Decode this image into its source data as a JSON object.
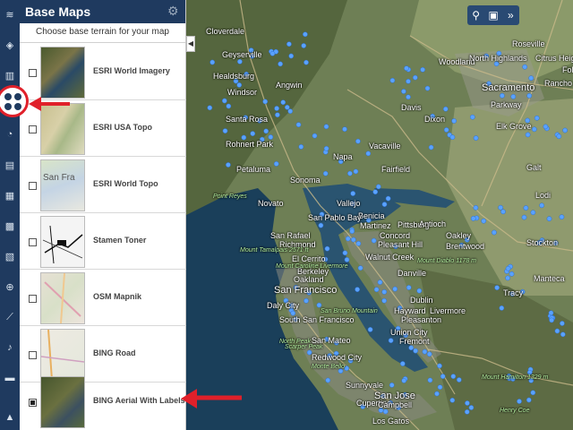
{
  "panel": {
    "title": "Base Maps",
    "subtitle": "Choose base terrain for your map",
    "items": [
      {
        "label": "ESRI World Imagery",
        "checked": false
      },
      {
        "label": "ESRI USA Topo",
        "checked": false
      },
      {
        "label": "ESRI World Topo",
        "checked": false
      },
      {
        "label": "Stamen Toner",
        "checked": false
      },
      {
        "label": "OSM Mapnik",
        "checked": false
      },
      {
        "label": "BING Road",
        "checked": false
      },
      {
        "label": "BING Aerial With Labels",
        "checked": true
      }
    ]
  },
  "thumb_text": {
    "world_topo": "San Fra"
  },
  "map": {
    "places": [
      {
        "name": "Cloverdale",
        "size": "n"
      },
      {
        "name": "Geyserville",
        "size": "n"
      },
      {
        "name": "Healdsburg",
        "size": "n"
      },
      {
        "name": "Windsor",
        "size": "n"
      },
      {
        "name": "Santa Rosa",
        "size": "n"
      },
      {
        "name": "Rohnert Park",
        "size": "n"
      },
      {
        "name": "Petaluma",
        "size": "n"
      },
      {
        "name": "Novato",
        "size": "n"
      },
      {
        "name": "San Rafael",
        "size": "n"
      },
      {
        "name": "Richmond",
        "size": "n"
      },
      {
        "name": "El Cerrito",
        "size": "n"
      },
      {
        "name": "Berkeley",
        "size": "n"
      },
      {
        "name": "Oakland",
        "size": "n"
      },
      {
        "name": "San Francisco",
        "size": "b"
      },
      {
        "name": "Daly City",
        "size": "n"
      },
      {
        "name": "South San Francisco",
        "size": "n"
      },
      {
        "name": "San Mateo",
        "size": "n"
      },
      {
        "name": "Redwood City",
        "size": "n"
      },
      {
        "name": "Sunnyvale",
        "size": "n"
      },
      {
        "name": "San Jose",
        "size": "b"
      },
      {
        "name": "Cupertino",
        "size": "n"
      },
      {
        "name": "Campbell",
        "size": "n"
      },
      {
        "name": "Los Gatos",
        "size": "n"
      },
      {
        "name": "Fremont",
        "size": "n"
      },
      {
        "name": "Union City",
        "size": "n"
      },
      {
        "name": "Hayward",
        "size": "n"
      },
      {
        "name": "Pleasanton",
        "size": "n"
      },
      {
        "name": "Livermore",
        "size": "n"
      },
      {
        "name": "Dublin",
        "size": "n"
      },
      {
        "name": "Danville",
        "size": "n"
      },
      {
        "name": "Walnut Creek",
        "size": "n"
      },
      {
        "name": "Concord",
        "size": "n"
      },
      {
        "name": "Pleasant Hill",
        "size": "n"
      },
      {
        "name": "Martinez",
        "size": "n"
      },
      {
        "name": "Pittsburg",
        "size": "n"
      },
      {
        "name": "Antioch",
        "size": "n"
      },
      {
        "name": "Oakley",
        "size": "n"
      },
      {
        "name": "Brentwood",
        "size": "n"
      },
      {
        "name": "Vallejo",
        "size": "n"
      },
      {
        "name": "Benicia",
        "size": "n"
      },
      {
        "name": "Napa",
        "size": "n"
      },
      {
        "name": "Fairfield",
        "size": "n"
      },
      {
        "name": "Vacaville",
        "size": "n"
      },
      {
        "name": "Dixon",
        "size": "n"
      },
      {
        "name": "Davis",
        "size": "n"
      },
      {
        "name": "Woodland",
        "size": "n"
      },
      {
        "name": "Sacramento",
        "size": "b"
      },
      {
        "name": "Elk Grove",
        "size": "n"
      },
      {
        "name": "Galt",
        "size": "n"
      },
      {
        "name": "Lodi",
        "size": "n"
      },
      {
        "name": "Stockton",
        "size": "n"
      },
      {
        "name": "Manteca",
        "size": "n"
      },
      {
        "name": "Tracy",
        "size": "n"
      },
      {
        "name": "Roseville",
        "size": "n"
      },
      {
        "name": "North Highlands",
        "size": "n"
      },
      {
        "name": "Citrus Heights",
        "size": "n"
      },
      {
        "name": "Folsom",
        "size": "n"
      },
      {
        "name": "Rancho Cordova",
        "size": "n"
      },
      {
        "name": "Parkway",
        "size": "n"
      },
      {
        "name": "Angwin",
        "size": "n"
      },
      {
        "name": "Sonoma",
        "size": "n"
      },
      {
        "name": "San Pablo Bay",
        "size": "n"
      },
      {
        "name": "Mount Tamalpais 2571 ft",
        "size": "g"
      },
      {
        "name": "Mount Caroline Livermore",
        "size": "g"
      },
      {
        "name": "Mount Diablo 1178 m",
        "size": "g"
      },
      {
        "name": "San Bruno Mountain",
        "size": "g"
      },
      {
        "name": "Monte Bello",
        "size": "g"
      },
      {
        "name": "Mount Hamilton 1329 m",
        "size": "g"
      },
      {
        "name": "Point Reyes",
        "size": "g"
      },
      {
        "name": "North Peak",
        "size": "g"
      },
      {
        "name": "Henry Coe",
        "size": "g"
      },
      {
        "name": "Scarper Peak",
        "size": "g"
      }
    ]
  }
}
